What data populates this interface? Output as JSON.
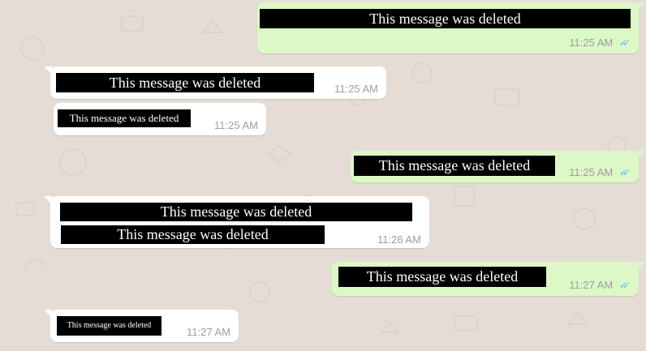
{
  "colors": {
    "wallpaper": "#e5ddd5",
    "incoming_bubble": "#ffffff",
    "outgoing_bubble": "#dcf8c6",
    "timestamp": "#9e9e9e",
    "read_ticks": "#4fc3f7"
  },
  "messages": [
    {
      "direction": "outgoing",
      "lines": [
        "This message was deleted"
      ],
      "time": "11:25 AM",
      "status": "read"
    },
    {
      "direction": "incoming",
      "lines": [
        "This message was deleted"
      ],
      "time": "11:25 AM"
    },
    {
      "direction": "incoming",
      "lines": [
        "This message was deleted"
      ],
      "time": "11:25 AM"
    },
    {
      "direction": "outgoing",
      "lines": [
        "This message was deleted"
      ],
      "time": "11:25 AM",
      "status": "read"
    },
    {
      "direction": "incoming",
      "lines": [
        "This message was deleted",
        "This message was deleted"
      ],
      "time": "11:26 AM"
    },
    {
      "direction": "outgoing",
      "lines": [
        "This message was deleted"
      ],
      "time": "11:27 AM",
      "status": "read"
    },
    {
      "direction": "incoming",
      "lines": [
        "This message was deleted"
      ],
      "time": "11:27 AM"
    }
  ],
  "icons": {
    "read_receipt": "double-check-icon"
  }
}
